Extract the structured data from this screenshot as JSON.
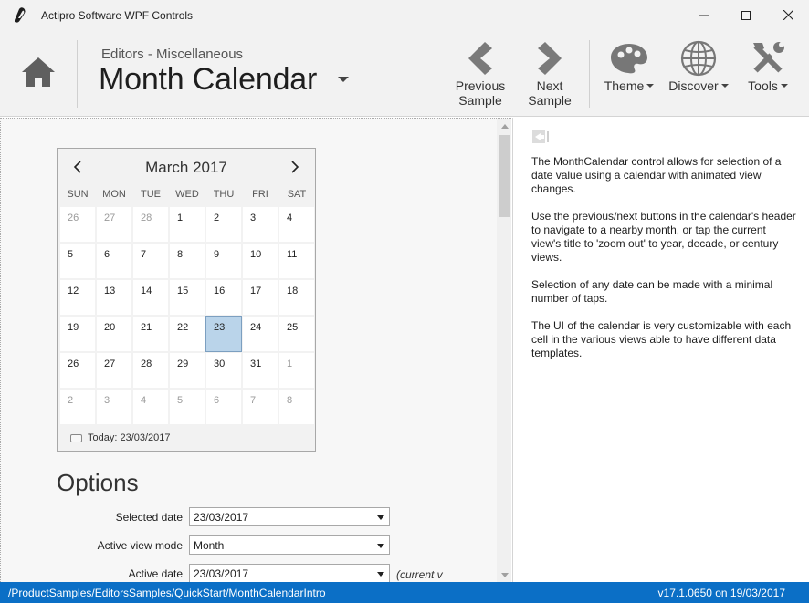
{
  "window": {
    "title": "Actipro Software WPF Controls",
    "minimize_icon": "minimize-icon",
    "maximize_icon": "maximize-icon",
    "close_icon": "close-icon"
  },
  "header": {
    "breadcrumb": "Editors - Miscellaneous",
    "title": "Month Calendar",
    "tools": {
      "previous": "Previous Sample",
      "next": "Next Sample",
      "theme": "Theme",
      "discover": "Discover",
      "tools": "Tools"
    }
  },
  "calendar": {
    "month_title": "March 2017",
    "day_names": [
      "SUN",
      "MON",
      "TUE",
      "WED",
      "THU",
      "FRI",
      "SAT"
    ],
    "days": [
      {
        "d": "26",
        "other": true
      },
      {
        "d": "27",
        "other": true
      },
      {
        "d": "28",
        "other": true
      },
      {
        "d": "1"
      },
      {
        "d": "2"
      },
      {
        "d": "3"
      },
      {
        "d": "4"
      },
      {
        "d": "5"
      },
      {
        "d": "6"
      },
      {
        "d": "7"
      },
      {
        "d": "8"
      },
      {
        "d": "9"
      },
      {
        "d": "10"
      },
      {
        "d": "11"
      },
      {
        "d": "12"
      },
      {
        "d": "13"
      },
      {
        "d": "14"
      },
      {
        "d": "15"
      },
      {
        "d": "16"
      },
      {
        "d": "17"
      },
      {
        "d": "18"
      },
      {
        "d": "19"
      },
      {
        "d": "20"
      },
      {
        "d": "21"
      },
      {
        "d": "22"
      },
      {
        "d": "23",
        "selected": true
      },
      {
        "d": "24"
      },
      {
        "d": "25"
      },
      {
        "d": "26"
      },
      {
        "d": "27"
      },
      {
        "d": "28"
      },
      {
        "d": "29"
      },
      {
        "d": "30"
      },
      {
        "d": "31"
      },
      {
        "d": "1",
        "other": true
      },
      {
        "d": "2",
        "other": true
      },
      {
        "d": "3",
        "other": true
      },
      {
        "d": "4",
        "other": true
      },
      {
        "d": "5",
        "other": true
      },
      {
        "d": "6",
        "other": true
      },
      {
        "d": "7",
        "other": true
      },
      {
        "d": "8",
        "other": true
      }
    ],
    "today_label": "Today: 23/03/2017"
  },
  "options": {
    "title": "Options",
    "selected_date_label": "Selected date",
    "selected_date_value": "23/03/2017",
    "active_view_mode_label": "Active view mode",
    "active_view_mode_value": "Month",
    "active_date_label": "Active date",
    "active_date_value": "23/03/2017",
    "active_date_note": "(current v"
  },
  "sidebar": {
    "paragraphs": [
      "The MonthCalendar control allows for selection of a date value using a calendar with animated view changes.",
      "Use the previous/next buttons in the calendar's header to navigate to a nearby month, or tap the current view's title to 'zoom out' to year, decade, or century views.",
      "Selection of any date can be made with a minimal number of taps.",
      "The UI of the calendar is very customizable with each cell in the various views able to have different data templates."
    ]
  },
  "status": {
    "path": "/ProductSamples/EditorsSamples/QuickStart/MonthCalendarIntro",
    "version": "v17.1.0650 on 19/03/2017"
  },
  "colors": {
    "status_bar": "#0b6fc6",
    "selected_day": "#bad4ea"
  }
}
